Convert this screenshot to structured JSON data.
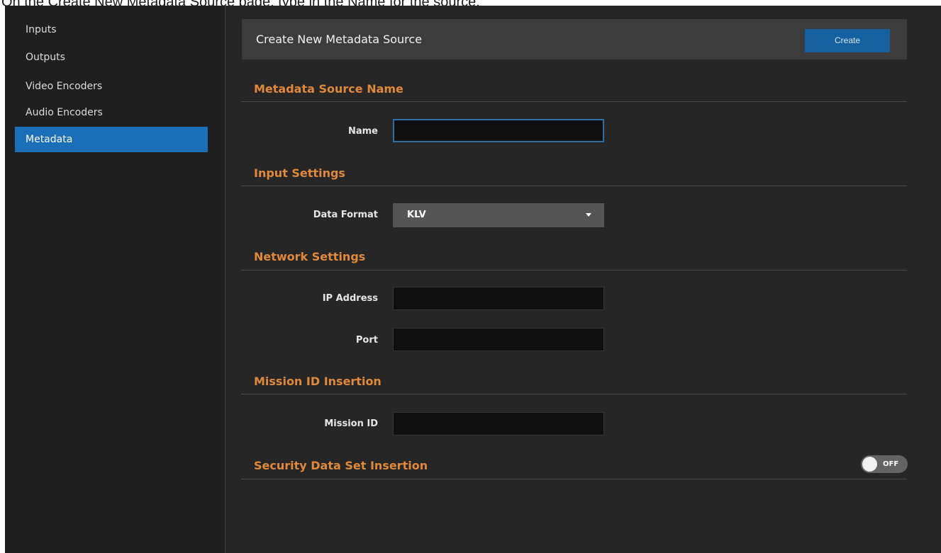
{
  "caption": "On the Create New Metadata Source page, type in the Name for the source.",
  "sidebar": {
    "items": [
      {
        "label": "Inputs"
      },
      {
        "label": "Outputs"
      },
      {
        "label": "Video Encoders"
      },
      {
        "label": "Audio Encoders"
      },
      {
        "label": "Metadata"
      }
    ],
    "active": "Metadata"
  },
  "header": {
    "title": "Create New Metadata Source",
    "create_label": "Create"
  },
  "sections": {
    "source_name": {
      "title": "Metadata Source Name",
      "name_label": "Name",
      "name_value": "",
      "name_placeholder": ""
    },
    "input_settings": {
      "title": "Input Settings",
      "data_format_label": "Data Format",
      "data_format_value": "KLV"
    },
    "network_settings": {
      "title": "Network Settings",
      "ip_label": "IP Address",
      "ip_value": "",
      "port_label": "Port",
      "port_value": ""
    },
    "mission": {
      "title": "Mission ID Insertion",
      "mission_label": "Mission ID",
      "mission_value": ""
    },
    "security": {
      "title": "Security Data Set Insertion",
      "toggle_label": "OFF",
      "toggle_on": false
    }
  },
  "colors": {
    "accent": "#1a6fb8",
    "section_title": "#e0893a",
    "background": "#262626",
    "sidebar": "#1f1f1f"
  },
  "icons": {
    "dropdown": "caret-down-icon",
    "toggle": "toggle-switch"
  }
}
